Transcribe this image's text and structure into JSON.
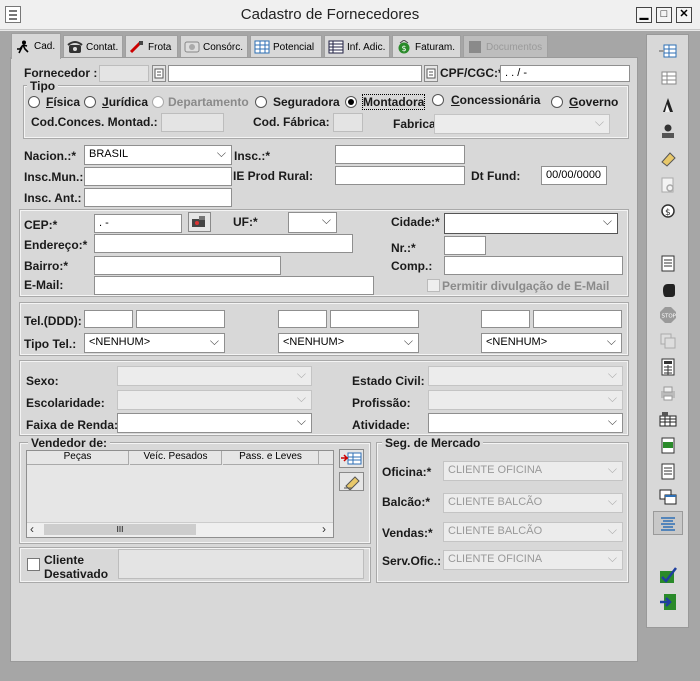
{
  "window": {
    "title": "Cadastro de Fornecedores",
    "min": "▁",
    "max": "□",
    "close": "✕"
  },
  "tabs": [
    {
      "label": "Cad.",
      "icon": "runner-icon"
    },
    {
      "label": "Contat.",
      "icon": "telephone-icon"
    },
    {
      "label": "Frota",
      "icon": "car-icon"
    },
    {
      "label": "Consórc.",
      "icon": "consortium-icon"
    },
    {
      "label": "Potencial",
      "icon": "grid-icon"
    },
    {
      "label": "Inf. Adic.",
      "icon": "table-icon"
    },
    {
      "label": "Faturam.",
      "icon": "money-icon"
    },
    {
      "label": "Documentos",
      "icon": "document-icon"
    }
  ],
  "fornecedor": {
    "label": "Fornecedor :",
    "code": "",
    "name": "",
    "cpf_label": "CPF/CGC:*",
    "cpf_value": " .  .  /    -  "
  },
  "tipo": {
    "legend": "Tipo",
    "options": [
      "Física",
      "Jurídica",
      "Departamento",
      "Seguradora",
      "Montadora",
      "Concessionária",
      "Governo"
    ],
    "selected": "Montadora"
  },
  "cod_conces": {
    "label": "Cod.Conces. Montad.:",
    "value": ""
  },
  "cod_fabrica": {
    "label": "Cod. Fábrica:",
    "value": ""
  },
  "fabricante": {
    "label": "Fabricante:",
    "value": ""
  },
  "nacion": {
    "label": "Nacion.:*",
    "value": "BRASIL"
  },
  "insc": {
    "label": "Insc.:*",
    "value": ""
  },
  "insc_mun": {
    "label": "Insc.Mun.:",
    "value": ""
  },
  "ie_prod_rural": {
    "label": "IE Prod Rural:",
    "value": ""
  },
  "dt_fund": {
    "label": "Dt Fund:",
    "value": "00/00/0000"
  },
  "insc_ant": {
    "label": "Insc. Ant.:",
    "value": ""
  },
  "cep": {
    "label": "CEP:*",
    "value": "  .   -"
  },
  "uf": {
    "label": "UF:*",
    "value": ""
  },
  "cidade": {
    "label": "Cidade:*",
    "value": ""
  },
  "endereco": {
    "label": "Endereço:*",
    "value": ""
  },
  "nr": {
    "label": "Nr.:*",
    "value": ""
  },
  "bairro": {
    "label": "Bairro:*",
    "value": ""
  },
  "comp": {
    "label": "Comp.:",
    "value": ""
  },
  "email": {
    "label": "E-Mail:",
    "value": "",
    "permit_label": "Permitir divulgação de E-Mail"
  },
  "phones": {
    "tel_label": "Tel.(DDD):",
    "tipo_label": "Tipo Tel.:",
    "tipo_values": [
      "<NENHUM>",
      "<NENHUM>",
      "<NENHUM>"
    ]
  },
  "perfil": {
    "sexo": "Sexo:",
    "escolaridade": "Escolaridade:",
    "faixa_renda": "Faixa de Renda:",
    "estado_civil": "Estado Civil:",
    "profissao": "Profissão:",
    "atividade": "Atividade:"
  },
  "vendedor": {
    "legend": "Vendedor de:",
    "columns": [
      "Peças",
      "Veíc. Pesados",
      "Pass. e Leves"
    ],
    "scroll_thumb": "III"
  },
  "seg_mercado": {
    "legend": "Seg. de Mercado",
    "oficina": {
      "label": "Oficina:*",
      "value": "CLIENTE OFICINA"
    },
    "balcao": {
      "label": "Balcão:*",
      "value": "CLIENTE BALCÃO"
    },
    "vendas": {
      "label": "Vendas:*",
      "value": "CLIENTE BALCÃO"
    },
    "serv_ofic": {
      "label": "Serv.Ofic.:",
      "value": "CLIENTE OFICINA"
    }
  },
  "cliente_desativado": {
    "label1": "Cliente",
    "label2": "Desativado"
  },
  "toolbar_icons": [
    "add-row-icon",
    "edit-grid-icon",
    "fire-icon",
    "stamp-icon",
    "eraser-icon",
    "preview-icon",
    "money-bag-icon",
    "document-icon",
    "hand-icon",
    "stop-icon",
    "copy-icon",
    "calculator-icon",
    "print-icon",
    "report-icon",
    "note-icon",
    "note-alt-icon",
    "window-copy-icon",
    "align-icon",
    "check-icon",
    "exit-icon"
  ],
  "colors": {
    "accent": "#2d6fb5",
    "green": "#2a8a2a"
  }
}
